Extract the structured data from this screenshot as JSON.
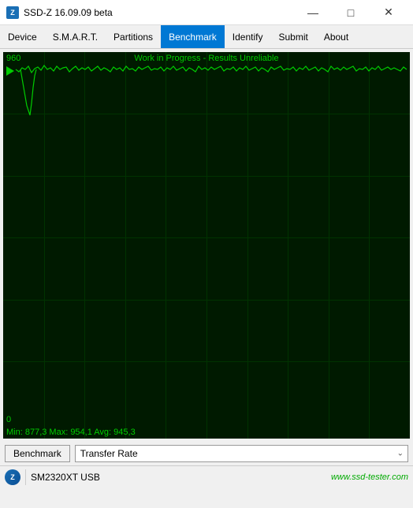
{
  "titlebar": {
    "icon_text": "Z",
    "title": "SSD-Z 16.09.09 beta",
    "minimize": "—",
    "maximize": "□",
    "close": "✕"
  },
  "menu": {
    "items": [
      {
        "label": "Device",
        "active": false
      },
      {
        "label": "S.M.A.R.T.",
        "active": false
      },
      {
        "label": "Partitions",
        "active": false
      },
      {
        "label": "Benchmark",
        "active": true
      },
      {
        "label": "Identify",
        "active": false
      },
      {
        "label": "Submit",
        "active": false
      },
      {
        "label": "About",
        "active": false
      }
    ]
  },
  "chart": {
    "warning_text": "Work in Progress - Results Unreliable",
    "label_max": "960",
    "label_min": "0",
    "stats_text": "Min: 877,3  Max: 954,1  Avg: 945,3"
  },
  "controls": {
    "benchmark_label": "Benchmark",
    "dropdown_value": "Transfer Rate",
    "dropdown_arrow": "⌄"
  },
  "statusbar": {
    "icon_text": "Z",
    "drive_text": "SM2320XT USB",
    "website": "www.ssd-tester.com"
  }
}
